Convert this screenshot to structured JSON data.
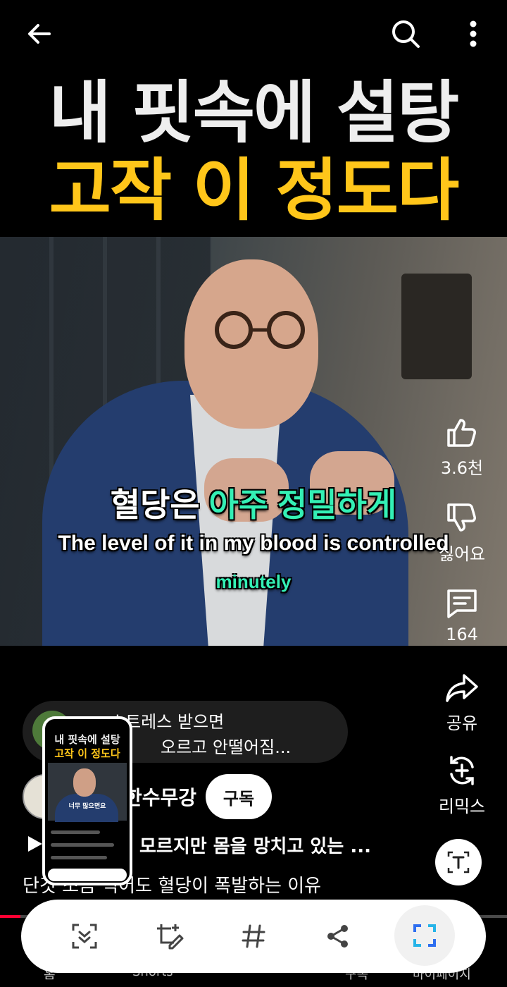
{
  "header": {
    "back_icon": "arrow-left-icon",
    "search_icon": "search-icon",
    "more_icon": "more-vertical-icon"
  },
  "video": {
    "title_line1": "내 핏속에 설탕",
    "title_line2": "고작 이 정도다",
    "subtitle_kr_part1": "혈당은",
    "subtitle_kr_part2": "아주 정밀하게",
    "subtitle_en_line1": "The level of it in my blood is controlled",
    "subtitle_en_line2": "minutely",
    "title_colors": {
      "line1": "#eeeeee",
      "line2": "#ffc61a",
      "accent": "#34f0b5"
    }
  },
  "actions": {
    "like_count": "3.6천",
    "dislike_label": "싫어요",
    "comment_count": "164",
    "share_label": "공유",
    "remix_label": "리믹스"
  },
  "comment": {
    "line1": "스트레스 받으면",
    "line2": "오르고 안떨어짐..."
  },
  "channel": {
    "name": "한수무강",
    "subscribe_label": "구독"
  },
  "audio": {
    "title": "모르지만 몸을 망치고 있는 ..."
  },
  "description": "단것 조금 먹어도 혈당이 폭발하는 이유",
  "progress": {
    "fraction": 0.04
  },
  "bottom_nav": {
    "home": "홈",
    "shorts": "Shorts",
    "subscriptions": "구독",
    "my_page": "마이페이지"
  },
  "screenshot_preview": {
    "title_line1": "내 핏속에 설탕",
    "title_line2": "고작 이 정도다",
    "subtitle": "너무 많으면요"
  },
  "text_extract_button": {
    "icon": "text-recognition-icon"
  },
  "capture_toolbar": {
    "scroll_capture_icon": "scroll-capture-icon",
    "draw_icon": "crop-edit-icon",
    "tag_icon": "hashtag-icon",
    "share_icon": "share-icon",
    "smart_select_icon": "smart-select-icon"
  }
}
